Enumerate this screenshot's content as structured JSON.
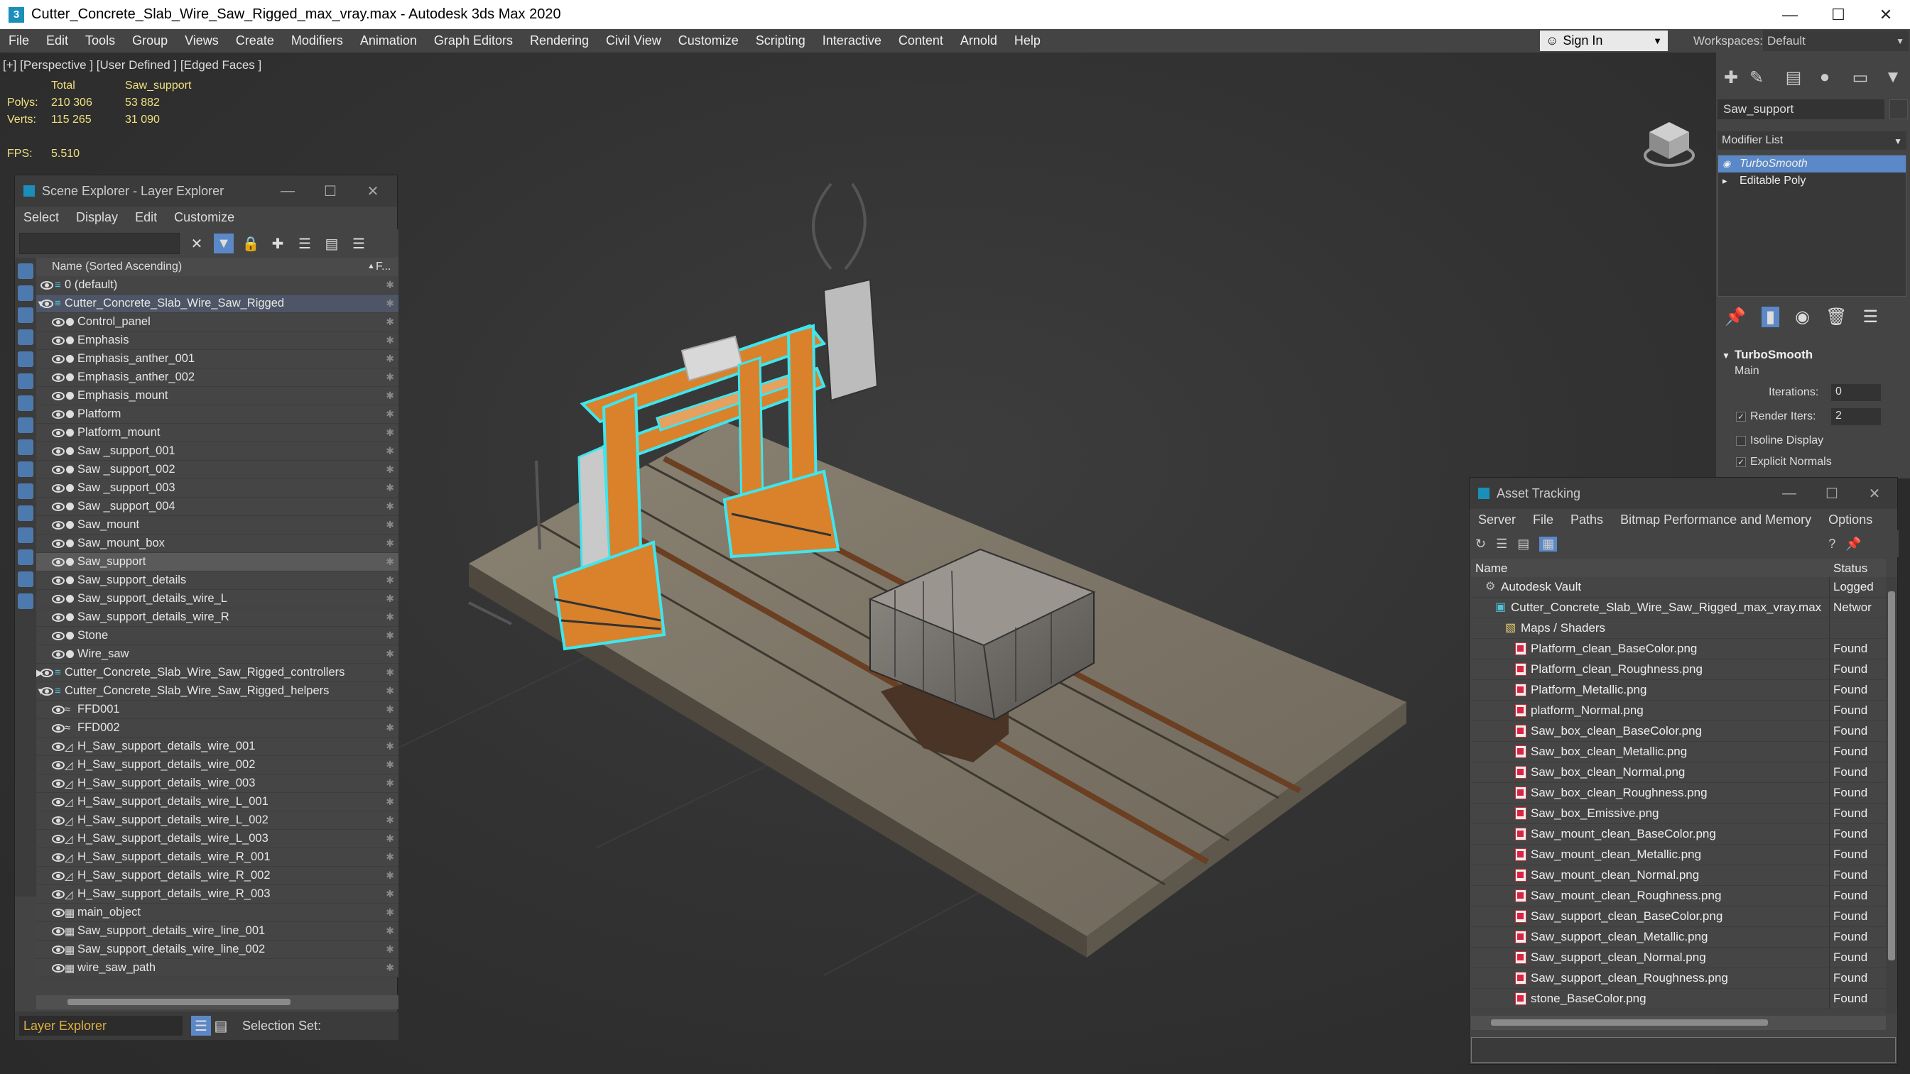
{
  "window": {
    "title": "Cutter_Concrete_Slab_Wire_Saw_Rigged_max_vray.max - Autodesk 3ds Max 2020",
    "app_icon": "3"
  },
  "menu": [
    "File",
    "Edit",
    "Tools",
    "Group",
    "Views",
    "Create",
    "Modifiers",
    "Animation",
    "Graph Editors",
    "Rendering",
    "Civil View",
    "Customize",
    "Scripting",
    "Interactive",
    "Content",
    "Arnold",
    "Help"
  ],
  "signin": {
    "label": "Sign In"
  },
  "workspaces": {
    "label": "Workspaces:",
    "value": "Default"
  },
  "viewport": {
    "label": "[+] [Perspective ] [User Defined ] [Edged Faces ]",
    "stats": {
      "total_label": "Total",
      "object_label": "Saw_support",
      "polys_label": "Polys:",
      "polys_total": "210 306",
      "polys_obj": "53 882",
      "verts_label": "Verts:",
      "verts_total": "115 265",
      "verts_obj": "31 090",
      "fps_label": "FPS:",
      "fps_value": "5.510"
    }
  },
  "scene_explorer": {
    "title": "Scene Explorer - Layer Explorer",
    "menu": [
      "Select",
      "Display",
      "Edit",
      "Customize"
    ],
    "column_header": "Name (Sorted Ascending)",
    "column_header_2": "F...",
    "rows": [
      {
        "label": "0 (default)",
        "indent": 0,
        "icon": "layer",
        "expand": ""
      },
      {
        "label": "Cutter_Concrete_Slab_Wire_Saw_Rigged",
        "indent": 0,
        "icon": "layer",
        "expand": "open",
        "highlight": true
      },
      {
        "label": "Control_panel",
        "indent": 1,
        "icon": "dot"
      },
      {
        "label": "Emphasis",
        "indent": 1,
        "icon": "dot"
      },
      {
        "label": "Emphasis_anther_001",
        "indent": 1,
        "icon": "dot"
      },
      {
        "label": "Emphasis_anther_002",
        "indent": 1,
        "icon": "dot"
      },
      {
        "label": "Emphasis_mount",
        "indent": 1,
        "icon": "dot"
      },
      {
        "label": "Platform",
        "indent": 1,
        "icon": "dot"
      },
      {
        "label": "Platform_mount",
        "indent": 1,
        "icon": "dot"
      },
      {
        "label": "Saw _support_001",
        "indent": 1,
        "icon": "dot"
      },
      {
        "label": "Saw _support_002",
        "indent": 1,
        "icon": "dot"
      },
      {
        "label": "Saw _support_003",
        "indent": 1,
        "icon": "dot"
      },
      {
        "label": "Saw _support_004",
        "indent": 1,
        "icon": "dot"
      },
      {
        "label": "Saw_mount",
        "indent": 1,
        "icon": "dot"
      },
      {
        "label": "Saw_mount_box",
        "indent": 1,
        "icon": "dot"
      },
      {
        "label": "Saw_support",
        "indent": 1,
        "icon": "dot",
        "selected": true
      },
      {
        "label": "Saw_support_details",
        "indent": 1,
        "icon": "dot"
      },
      {
        "label": "Saw_support_details_wire_L",
        "indent": 1,
        "icon": "dot"
      },
      {
        "label": "Saw_support_details_wire_R",
        "indent": 1,
        "icon": "dot"
      },
      {
        "label": "Stone",
        "indent": 1,
        "icon": "dot"
      },
      {
        "label": "Wire_saw",
        "indent": 1,
        "icon": "dot"
      },
      {
        "label": "Cutter_Concrete_Slab_Wire_Saw_Rigged_controllers",
        "indent": 0,
        "icon": "layer",
        "expand": "closed"
      },
      {
        "label": "Cutter_Concrete_Slab_Wire_Saw_Rigged_helpers",
        "indent": 0,
        "icon": "layer",
        "expand": "open"
      },
      {
        "label": "FFD001",
        "indent": 1,
        "icon": "ffd"
      },
      {
        "label": "FFD002",
        "indent": 1,
        "icon": "ffd"
      },
      {
        "label": "H_Saw_support_details_wire_001",
        "indent": 1,
        "icon": "helper"
      },
      {
        "label": "H_Saw_support_details_wire_002",
        "indent": 1,
        "icon": "helper"
      },
      {
        "label": "H_Saw_support_details_wire_003",
        "indent": 1,
        "icon": "helper"
      },
      {
        "label": "H_Saw_support_details_wire_L_001",
        "indent": 1,
        "icon": "helper"
      },
      {
        "label": "H_Saw_support_details_wire_L_002",
        "indent": 1,
        "icon": "helper"
      },
      {
        "label": "H_Saw_support_details_wire_L_003",
        "indent": 1,
        "icon": "helper"
      },
      {
        "label": "H_Saw_support_details_wire_R_001",
        "indent": 1,
        "icon": "helper"
      },
      {
        "label": "H_Saw_support_details_wire_R_002",
        "indent": 1,
        "icon": "helper"
      },
      {
        "label": "H_Saw_support_details_wire_R_003",
        "indent": 1,
        "icon": "helper"
      },
      {
        "label": "main_object",
        "indent": 1,
        "icon": "shape"
      },
      {
        "label": "Saw_support_details_wire_line_001",
        "indent": 1,
        "icon": "shape"
      },
      {
        "label": "Saw_support_details_wire_line_002",
        "indent": 1,
        "icon": "shape"
      },
      {
        "label": "wire_saw_path",
        "indent": 1,
        "icon": "shape"
      }
    ],
    "bottom": {
      "explorer": "Layer Explorer",
      "selection_set_label": "Selection Set:"
    }
  },
  "command_panel": {
    "object_name": "Saw_support",
    "modifier_list": "Modifier List",
    "stack": [
      {
        "label": "TurboSmooth",
        "selected": true
      },
      {
        "label": "Editable Poly",
        "selected": false
      }
    ],
    "turbosmooth": {
      "header": "TurboSmooth",
      "main": "Main",
      "iterations_label": "Iterations:",
      "iterations_value": "0",
      "render_iters_label": "Render Iters:",
      "render_iters_value": "2",
      "isoline_label": "Isoline Display",
      "explicit_label": "Explicit Normals"
    }
  },
  "asset_tracking": {
    "title": "Asset Tracking",
    "menu": [
      "Server",
      "File",
      "Paths",
      "Bitmap Performance and Memory",
      "Options"
    ],
    "col_name": "Name",
    "col_status": "Status",
    "rows": [
      {
        "name": "Autodesk Vault",
        "status": "Logged",
        "indent": 1,
        "icon": "vault"
      },
      {
        "name": "Cutter_Concrete_Slab_Wire_Saw_Rigged_max_vray.max",
        "status": "Networ",
        "indent": 2,
        "icon": "max"
      },
      {
        "name": "Maps / Shaders",
        "status": "",
        "indent": 3,
        "icon": "folder"
      },
      {
        "name": "Platform_clean_BaseColor.png",
        "status": "Found",
        "indent": 4,
        "icon": "file"
      },
      {
        "name": "Platform_clean_Roughness.png",
        "status": "Found",
        "indent": 4,
        "icon": "file"
      },
      {
        "name": "Platform_Metallic.png",
        "status": "Found",
        "indent": 4,
        "icon": "file"
      },
      {
        "name": "platform_Normal.png",
        "status": "Found",
        "indent": 4,
        "icon": "file"
      },
      {
        "name": "Saw_box_clean_BaseColor.png",
        "status": "Found",
        "indent": 4,
        "icon": "file"
      },
      {
        "name": "Saw_box_clean_Metallic.png",
        "status": "Found",
        "indent": 4,
        "icon": "file"
      },
      {
        "name": "Saw_box_clean_Normal.png",
        "status": "Found",
        "indent": 4,
        "icon": "file"
      },
      {
        "name": "Saw_box_clean_Roughness.png",
        "status": "Found",
        "indent": 4,
        "icon": "file"
      },
      {
        "name": "Saw_box_Emissive.png",
        "status": "Found",
        "indent": 4,
        "icon": "file"
      },
      {
        "name": "Saw_mount_clean_BaseColor.png",
        "status": "Found",
        "indent": 4,
        "icon": "file"
      },
      {
        "name": "Saw_mount_clean_Metallic.png",
        "status": "Found",
        "indent": 4,
        "icon": "file"
      },
      {
        "name": "Saw_mount_clean_Normal.png",
        "status": "Found",
        "indent": 4,
        "icon": "file"
      },
      {
        "name": "Saw_mount_clean_Roughness.png",
        "status": "Found",
        "indent": 4,
        "icon": "file"
      },
      {
        "name": "Saw_support_clean_BaseColor.png",
        "status": "Found",
        "indent": 4,
        "icon": "file"
      },
      {
        "name": "Saw_support_clean_Metallic.png",
        "status": "Found",
        "indent": 4,
        "icon": "file"
      },
      {
        "name": "Saw_support_clean_Normal.png",
        "status": "Found",
        "indent": 4,
        "icon": "file"
      },
      {
        "name": "Saw_support_clean_Roughness.png",
        "status": "Found",
        "indent": 4,
        "icon": "file"
      },
      {
        "name": "stone_BaseColor.png",
        "status": "Found",
        "indent": 4,
        "icon": "file"
      }
    ]
  },
  "colors": {
    "accent": "#5b88c7",
    "selection_outline": "#3ee6f0",
    "rig_orange": "#d9822b",
    "stats_yellow": "#f0e080"
  }
}
